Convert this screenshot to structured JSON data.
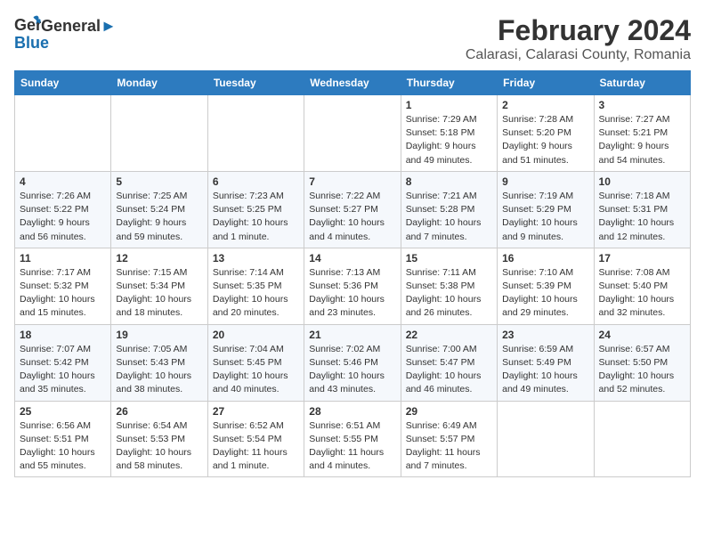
{
  "header": {
    "logo_general": "General",
    "logo_blue": "Blue",
    "title": "February 2024",
    "subtitle": "Calarasi, Calarasi County, Romania"
  },
  "calendar": {
    "days_of_week": [
      "Sunday",
      "Monday",
      "Tuesday",
      "Wednesday",
      "Thursday",
      "Friday",
      "Saturday"
    ],
    "weeks": [
      [
        {
          "day": "",
          "info": ""
        },
        {
          "day": "",
          "info": ""
        },
        {
          "day": "",
          "info": ""
        },
        {
          "day": "",
          "info": ""
        },
        {
          "day": "1",
          "info": "Sunrise: 7:29 AM\nSunset: 5:18 PM\nDaylight: 9 hours and 49 minutes."
        },
        {
          "day": "2",
          "info": "Sunrise: 7:28 AM\nSunset: 5:20 PM\nDaylight: 9 hours and 51 minutes."
        },
        {
          "day": "3",
          "info": "Sunrise: 7:27 AM\nSunset: 5:21 PM\nDaylight: 9 hours and 54 minutes."
        }
      ],
      [
        {
          "day": "4",
          "info": "Sunrise: 7:26 AM\nSunset: 5:22 PM\nDaylight: 9 hours and 56 minutes."
        },
        {
          "day": "5",
          "info": "Sunrise: 7:25 AM\nSunset: 5:24 PM\nDaylight: 9 hours and 59 minutes."
        },
        {
          "day": "6",
          "info": "Sunrise: 7:23 AM\nSunset: 5:25 PM\nDaylight: 10 hours and 1 minute."
        },
        {
          "day": "7",
          "info": "Sunrise: 7:22 AM\nSunset: 5:27 PM\nDaylight: 10 hours and 4 minutes."
        },
        {
          "day": "8",
          "info": "Sunrise: 7:21 AM\nSunset: 5:28 PM\nDaylight: 10 hours and 7 minutes."
        },
        {
          "day": "9",
          "info": "Sunrise: 7:19 AM\nSunset: 5:29 PM\nDaylight: 10 hours and 9 minutes."
        },
        {
          "day": "10",
          "info": "Sunrise: 7:18 AM\nSunset: 5:31 PM\nDaylight: 10 hours and 12 minutes."
        }
      ],
      [
        {
          "day": "11",
          "info": "Sunrise: 7:17 AM\nSunset: 5:32 PM\nDaylight: 10 hours and 15 minutes."
        },
        {
          "day": "12",
          "info": "Sunrise: 7:15 AM\nSunset: 5:34 PM\nDaylight: 10 hours and 18 minutes."
        },
        {
          "day": "13",
          "info": "Sunrise: 7:14 AM\nSunset: 5:35 PM\nDaylight: 10 hours and 20 minutes."
        },
        {
          "day": "14",
          "info": "Sunrise: 7:13 AM\nSunset: 5:36 PM\nDaylight: 10 hours and 23 minutes."
        },
        {
          "day": "15",
          "info": "Sunrise: 7:11 AM\nSunset: 5:38 PM\nDaylight: 10 hours and 26 minutes."
        },
        {
          "day": "16",
          "info": "Sunrise: 7:10 AM\nSunset: 5:39 PM\nDaylight: 10 hours and 29 minutes."
        },
        {
          "day": "17",
          "info": "Sunrise: 7:08 AM\nSunset: 5:40 PM\nDaylight: 10 hours and 32 minutes."
        }
      ],
      [
        {
          "day": "18",
          "info": "Sunrise: 7:07 AM\nSunset: 5:42 PM\nDaylight: 10 hours and 35 minutes."
        },
        {
          "day": "19",
          "info": "Sunrise: 7:05 AM\nSunset: 5:43 PM\nDaylight: 10 hours and 38 minutes."
        },
        {
          "day": "20",
          "info": "Sunrise: 7:04 AM\nSunset: 5:45 PM\nDaylight: 10 hours and 40 minutes."
        },
        {
          "day": "21",
          "info": "Sunrise: 7:02 AM\nSunset: 5:46 PM\nDaylight: 10 hours and 43 minutes."
        },
        {
          "day": "22",
          "info": "Sunrise: 7:00 AM\nSunset: 5:47 PM\nDaylight: 10 hours and 46 minutes."
        },
        {
          "day": "23",
          "info": "Sunrise: 6:59 AM\nSunset: 5:49 PM\nDaylight: 10 hours and 49 minutes."
        },
        {
          "day": "24",
          "info": "Sunrise: 6:57 AM\nSunset: 5:50 PM\nDaylight: 10 hours and 52 minutes."
        }
      ],
      [
        {
          "day": "25",
          "info": "Sunrise: 6:56 AM\nSunset: 5:51 PM\nDaylight: 10 hours and 55 minutes."
        },
        {
          "day": "26",
          "info": "Sunrise: 6:54 AM\nSunset: 5:53 PM\nDaylight: 10 hours and 58 minutes."
        },
        {
          "day": "27",
          "info": "Sunrise: 6:52 AM\nSunset: 5:54 PM\nDaylight: 11 hours and 1 minute."
        },
        {
          "day": "28",
          "info": "Sunrise: 6:51 AM\nSunset: 5:55 PM\nDaylight: 11 hours and 4 minutes."
        },
        {
          "day": "29",
          "info": "Sunrise: 6:49 AM\nSunset: 5:57 PM\nDaylight: 11 hours and 7 minutes."
        },
        {
          "day": "",
          "info": ""
        },
        {
          "day": "",
          "info": ""
        }
      ]
    ]
  }
}
